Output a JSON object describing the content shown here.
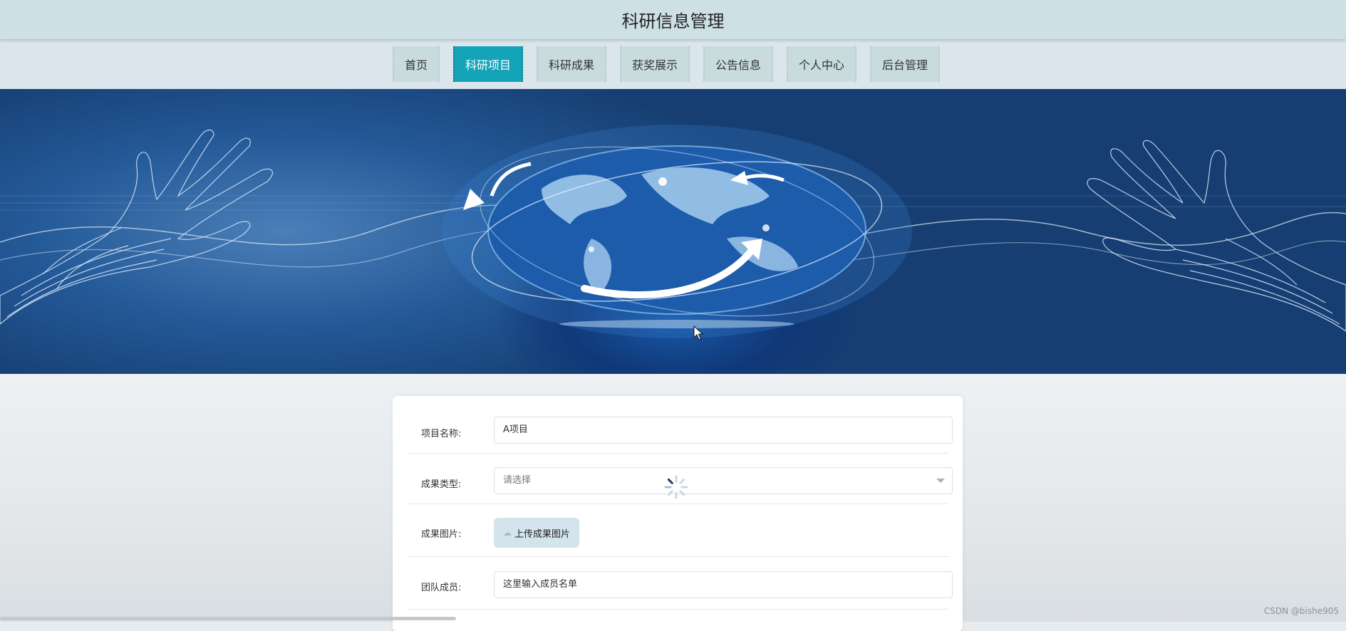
{
  "header": {
    "title": "科研信息管理"
  },
  "nav": {
    "items": [
      {
        "label": "首页",
        "active": false
      },
      {
        "label": "科研项目",
        "active": true
      },
      {
        "label": "科研成果",
        "active": false
      },
      {
        "label": "获奖展示",
        "active": false
      },
      {
        "label": "公告信息",
        "active": false
      },
      {
        "label": "个人中心",
        "active": false
      },
      {
        "label": "后台管理",
        "active": false
      }
    ]
  },
  "banner": {
    "icon": "globe-network-banner"
  },
  "form": {
    "project_name": {
      "label": "项目名称:",
      "value": "A项目"
    },
    "result_type": {
      "label": "成果类型:",
      "placeholder": "请选择"
    },
    "result_image": {
      "label": "成果图片:",
      "button_label": "上传成果图片"
    },
    "team_members": {
      "label": "团队成员:",
      "value": "这里输入成员名单"
    }
  },
  "watermark": "CSDN @bishe905",
  "colors": {
    "accent": "#13a4b8",
    "header_bg": "#cde0e6",
    "nav_bg": "#dbe6ec"
  }
}
